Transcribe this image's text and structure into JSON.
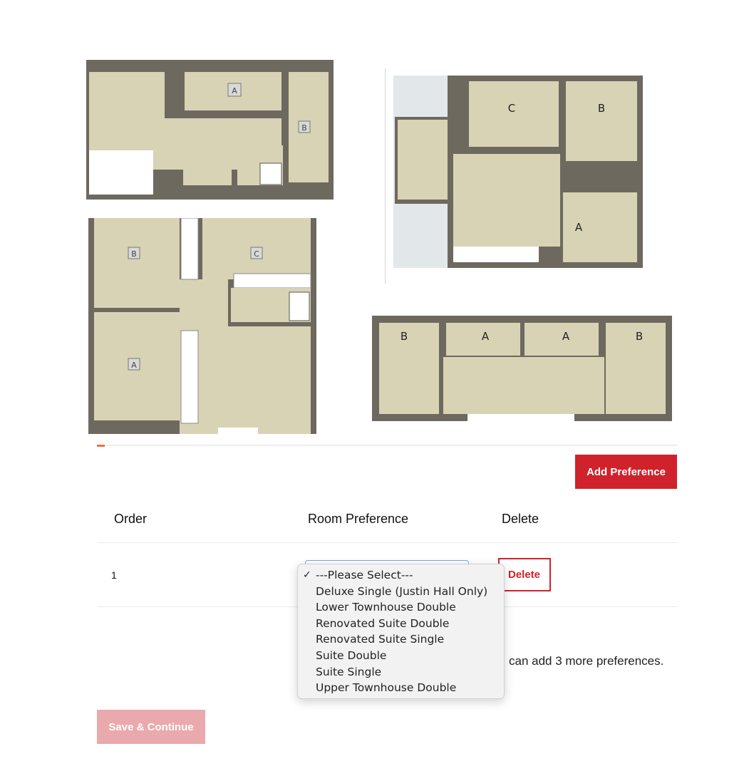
{
  "floor_plans": [
    {
      "name": "plan-1",
      "room_tags": [
        "A",
        "B"
      ]
    },
    {
      "name": "plan-2",
      "room_tags": [
        "C",
        "B",
        "A"
      ]
    },
    {
      "name": "plan-3",
      "room_tags": [
        "B",
        "C",
        "A"
      ]
    },
    {
      "name": "plan-4",
      "room_tags": [
        "B",
        "A",
        "A",
        "B"
      ]
    }
  ],
  "actions": {
    "add_preference_label": "Add Preference",
    "save_continue_label": "Save & Continue"
  },
  "table": {
    "headers": {
      "order": "Order",
      "room_preference": "Room Preference",
      "delete": "Delete"
    },
    "rows": [
      {
        "order": "1",
        "room_preference": "---Please Select---",
        "delete_label": "Delete"
      }
    ]
  },
  "dropdown": {
    "selected_index": 0,
    "check_glyph": "✓",
    "options": [
      "---Please Select---",
      "Deluxe Single (Justin Hall Only)",
      "Lower Townhouse Double",
      "Renovated Suite Double",
      "Renovated Suite Single",
      "Suite Double",
      "Suite Single",
      "Upper Townhouse Double"
    ]
  },
  "remaining_text": "can add 3 more preferences.",
  "colors": {
    "primary": "#d0222c",
    "primary_disabled": "#eaa9ac",
    "accent": "#e8743b",
    "plan_wall": "#6e695f",
    "plan_floor": "#d8d3b4"
  }
}
